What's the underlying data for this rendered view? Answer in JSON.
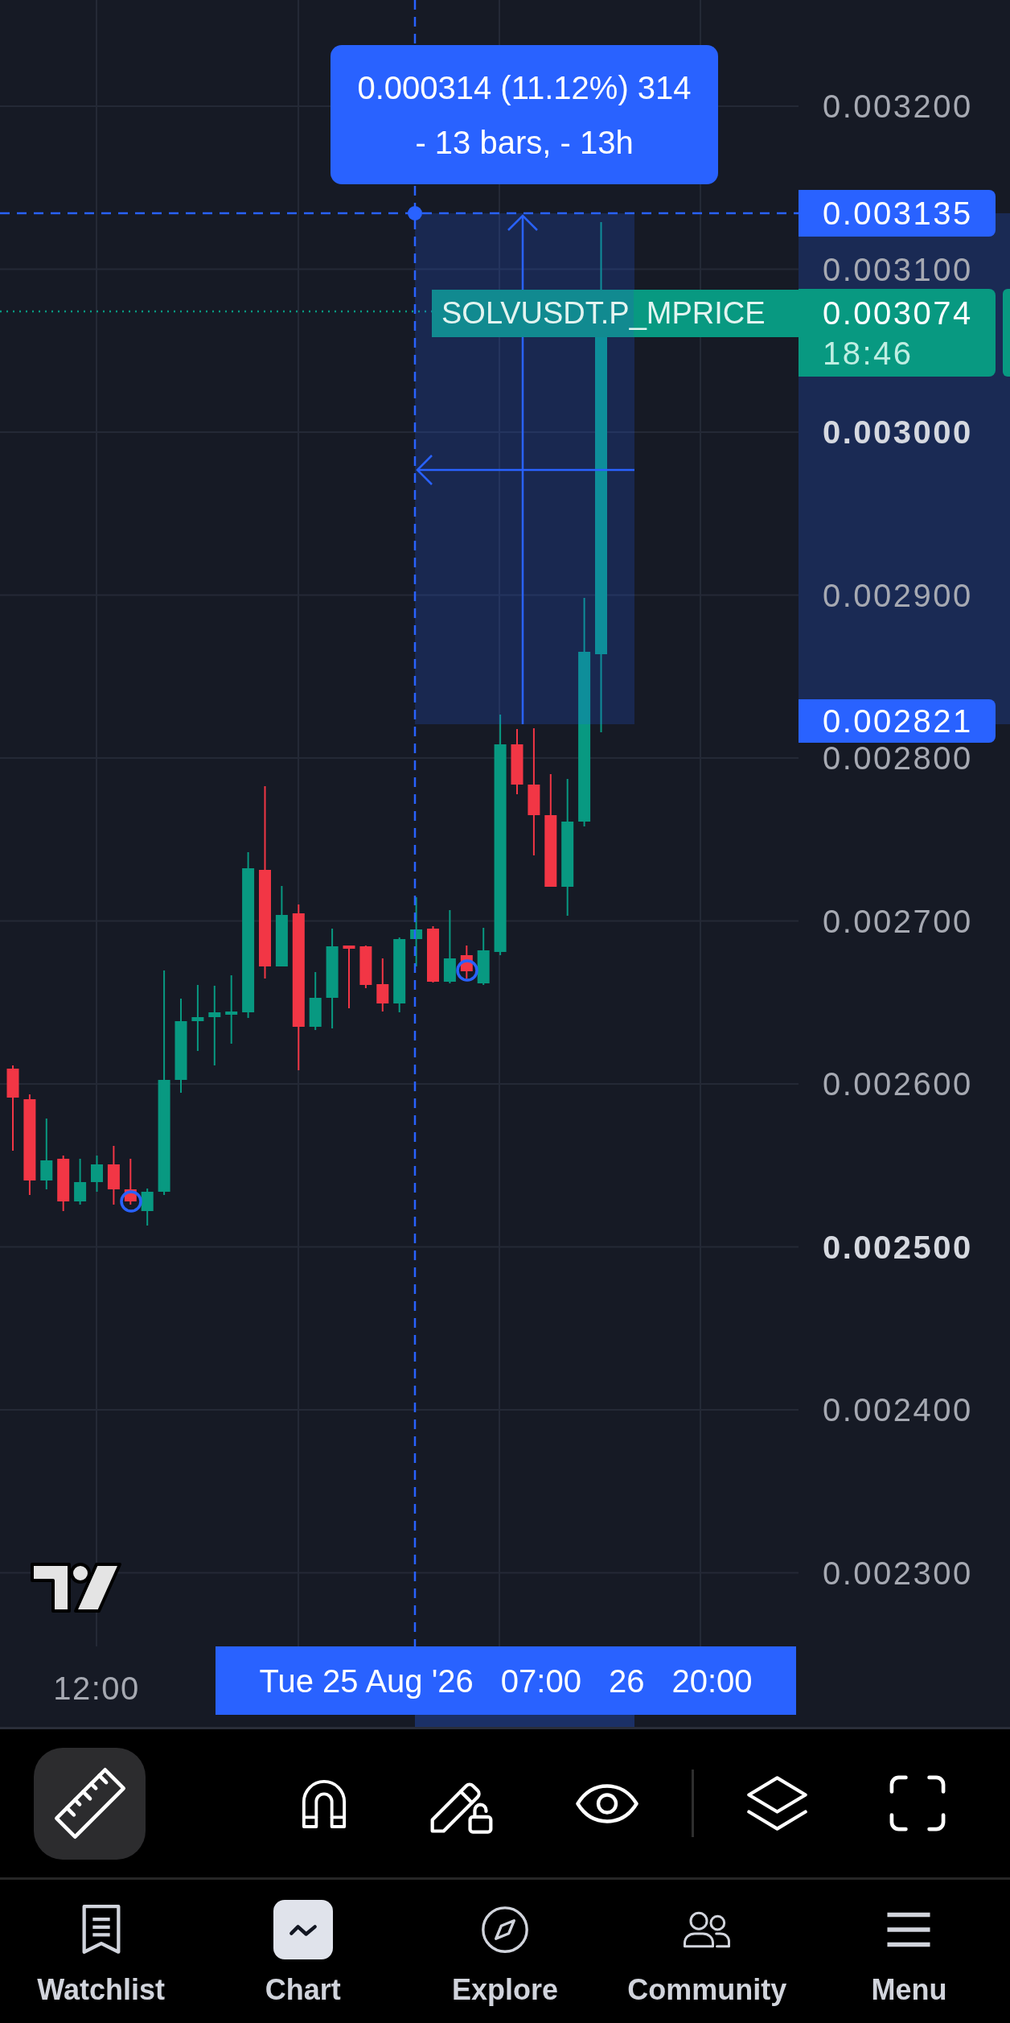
{
  "chart": {
    "measure_tooltip": {
      "change": "0.000314 (11.12%) 314",
      "span": "- 13 bars, - 13h"
    },
    "symbol_label": "SOLVUSDT.P_MPRICE"
  },
  "price_axis": {
    "labels": [
      {
        "text": "0.003200",
        "bold": false
      },
      {
        "text": "0.003100",
        "bold": false
      },
      {
        "text": "0.003000",
        "bold": true
      },
      {
        "text": "0.002900",
        "bold": false
      },
      {
        "text": "0.002800",
        "bold": false
      },
      {
        "text": "0.002700",
        "bold": false
      },
      {
        "text": "0.002600",
        "bold": false
      },
      {
        "text": "0.002500",
        "bold": true
      },
      {
        "text": "0.002400",
        "bold": false
      },
      {
        "text": "0.002300",
        "bold": false
      }
    ],
    "tags": [
      {
        "kind": "range",
        "price": "0.003135"
      },
      {
        "kind": "last",
        "price": "0.003074",
        "countdown": "18:46"
      },
      {
        "kind": "range",
        "price": "0.002821"
      }
    ]
  },
  "time_axis": {
    "labels": [
      "12:00"
    ],
    "range_label": [
      "Tue 25 Aug '26",
      "07:00",
      "26",
      "20:00"
    ]
  },
  "toolbar": {
    "tools": [
      {
        "selected": true
      },
      {
        "selected": false
      },
      {
        "selected": false
      },
      {
        "selected": false
      },
      {
        "selected": false
      },
      {
        "selected": false
      }
    ]
  },
  "nav": [
    {
      "label": "Watchlist",
      "selected": false
    },
    {
      "label": "Chart",
      "selected": true
    },
    {
      "label": "Explore",
      "selected": false
    },
    {
      "label": "Community",
      "selected": false
    },
    {
      "label": "Menu",
      "selected": false
    }
  ]
}
